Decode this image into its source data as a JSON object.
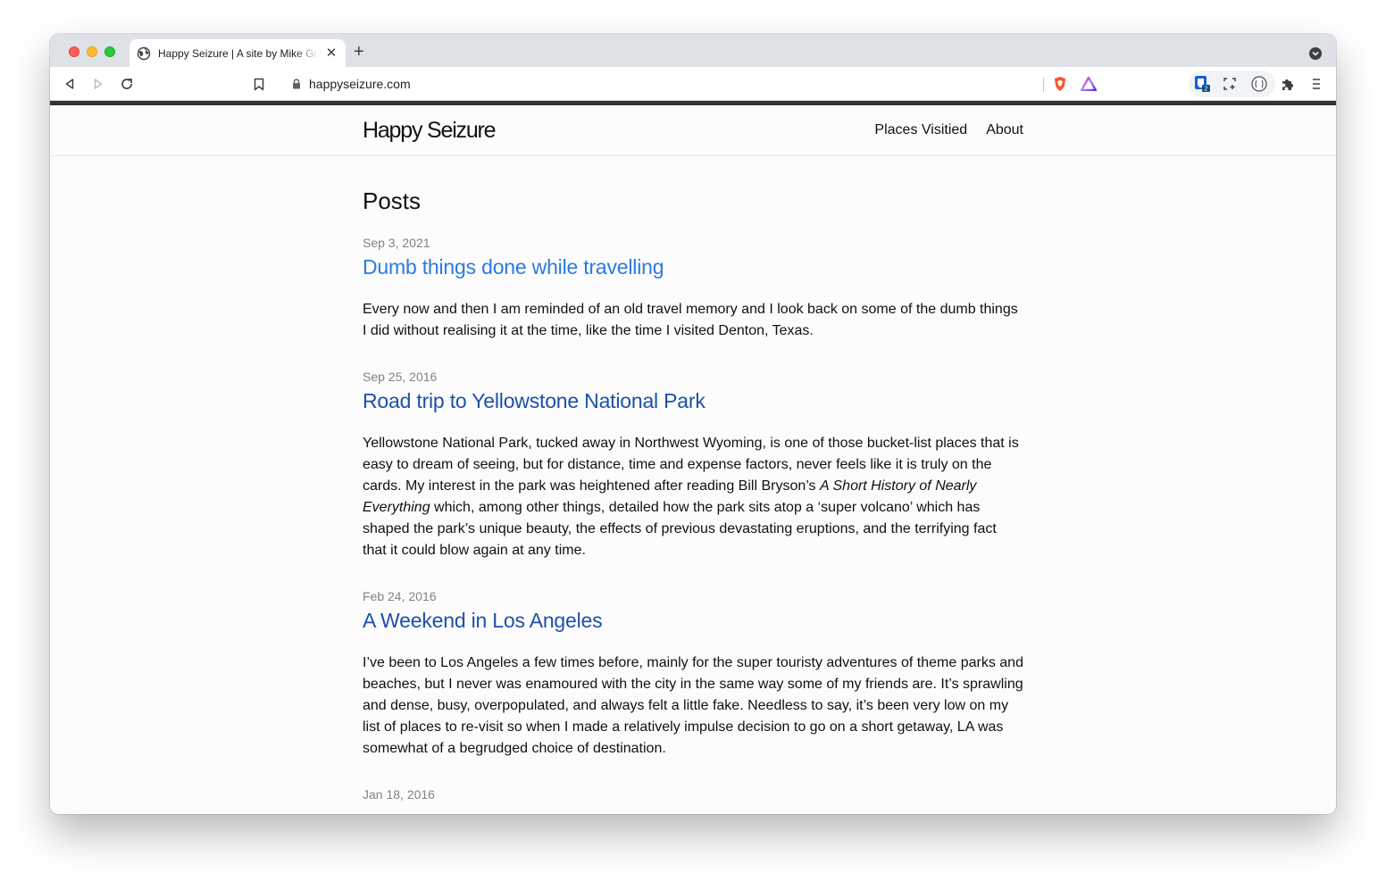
{
  "browser": {
    "tab": {
      "title": "Happy Seizure | A site by Mike Gray",
      "close_label": "✕"
    },
    "new_tab_label": "+",
    "address": {
      "url": "happyseizure.com"
    },
    "extensions": {
      "bitwarden_badge": "2"
    }
  },
  "site": {
    "title": "Happy Seizure",
    "nav": [
      {
        "label": "Places Visitied"
      },
      {
        "label": "About"
      }
    ]
  },
  "main": {
    "heading": "Posts",
    "posts": [
      {
        "date": "Sep 3, 2021",
        "title": "Dumb things done while travelling",
        "excerpt": [
          {
            "text": "Every now and then I am reminded of an old travel memory and I look back on some of the dumb things I did without realising it at the time, like the time I visited Denton, Texas."
          }
        ]
      },
      {
        "date": "Sep 25, 2016",
        "title": "Road trip to Yellowstone National Park",
        "excerpt": [
          {
            "text": "Yellowstone National Park, tucked away in Northwest Wyoming, is one of those bucket-list places that is easy to dream of seeing, but for distance, time and expense factors, never feels like it is truly on the cards. My interest in the park was heightened after reading Bill Bryson’s "
          },
          {
            "text": "A Short History of Nearly Everything",
            "italic": true
          },
          {
            "text": " which, among other things, detailed how the park sits atop a ‘super volcano’ which has shaped the park’s unique beauty, the effects of previous devastating eruptions, and the terrifying fact that it could blow again at any time."
          }
        ]
      },
      {
        "date": "Feb 24, 2016",
        "title": "A Weekend in Los Angeles",
        "excerpt": [
          {
            "text": "I’ve been to Los Angeles a few times before, mainly for the super touristy adventures of theme parks and beaches, but I never was enamoured with the city in the same way some of my friends are. It’s sprawling and dense, busy, overpopulated, and always felt a little fake. Needless to say, it’s been very low on my list of places to re-visit so when I made a relatively impulse decision to go on a short getaway, LA was somewhat of a begrudged choice of destination."
          }
        ]
      },
      {
        "date": "Jan 18, 2016",
        "title": "",
        "excerpt": []
      }
    ]
  },
  "colors": {
    "link": "#1e50a8",
    "link_hover": "#2a7ae2",
    "date": "#828282",
    "text": "#111111",
    "chrome_tabstrip": "#dee1e6"
  }
}
